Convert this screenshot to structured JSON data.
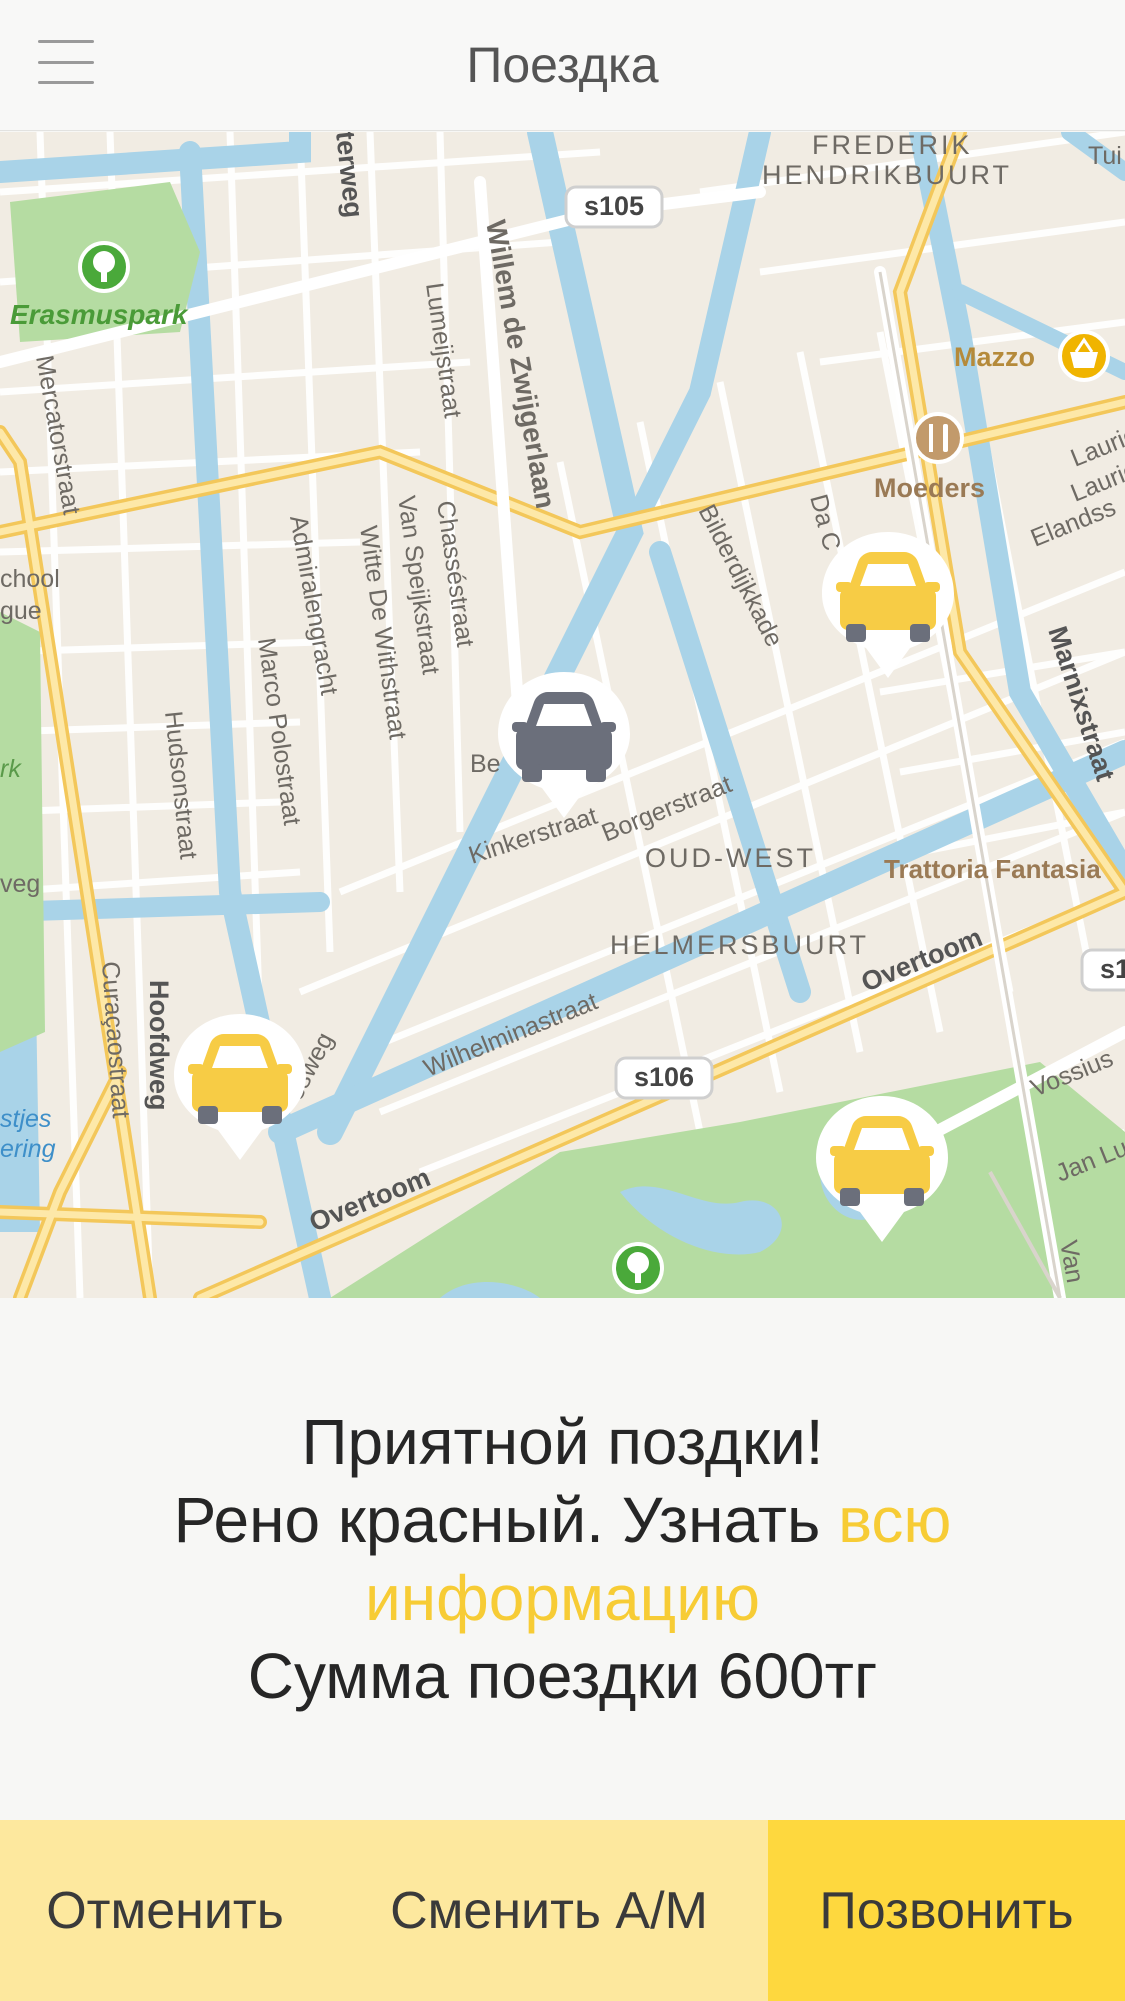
{
  "header": {
    "title": "Поездка",
    "menu_icon": "hamburger-menu-icon"
  },
  "map": {
    "road_labels": [
      "s105",
      "s106",
      "s1"
    ],
    "district_labels": [
      "FREDERIK",
      "HENDRIKBUURT",
      "OUD-WEST",
      "HELMERSBUURT"
    ],
    "street_labels": [
      "Willem de Zwijgerlaan",
      "Lumeijstraat",
      "Mercatorstraat",
      "Admiralengracht",
      "Witte De Withstraat",
      "Van Speijkstraat",
      "Chasséstraat",
      "Marco Polostraat",
      "Hudsonstraat",
      "Bilderdijkkade",
      "Borgerstraat",
      "Kinkerstraat",
      "Wilhelminastraat",
      "Overtoom",
      "Overtoom",
      "Hoofdweg",
      "Curaçaostraat",
      "Marnixstraat",
      "Vossius",
      "Jan Lu",
      "Laurier",
      "Laurier",
      "Elandss",
      "Da C",
      "Be",
      "Van",
      "Tui",
      "terweg",
      "esweg",
      "veg",
      "chool",
      "gue",
      "rk",
      "stjes",
      "ering"
    ],
    "poi_labels": [
      "Erasmuspark",
      "Mazzo",
      "Moeders",
      "Trattoria Fantasia"
    ],
    "poi_icons": [
      "park-tree-icon",
      "shopping-basket-icon",
      "restaurant-fork-knife-icon",
      "park-tree-icon"
    ],
    "cars": [
      {
        "name": "selected-car-marker",
        "color": "#6b6f7b"
      },
      {
        "name": "taxi-marker",
        "color": "#f7cc45"
      },
      {
        "name": "taxi-marker",
        "color": "#f7cc45"
      },
      {
        "name": "taxi-marker",
        "color": "#f7cc45"
      }
    ]
  },
  "info": {
    "greeting": "Приятной поздки!",
    "car_text": "Рено красный. Узнать ",
    "link_text": "всю информацию",
    "sum_text": "Сумма поездки 600тг"
  },
  "actions": {
    "cancel": "Отменить",
    "change": "Сменить А/М",
    "call": "Позвонить"
  },
  "colors": {
    "accent": "#f7cc35",
    "button_light": "#fde89e",
    "button_strong": "#fed83e",
    "water": "#a9d3e8",
    "park": "#b5dca2",
    "road": "#ffffff",
    "major_road": "#f9d774"
  }
}
